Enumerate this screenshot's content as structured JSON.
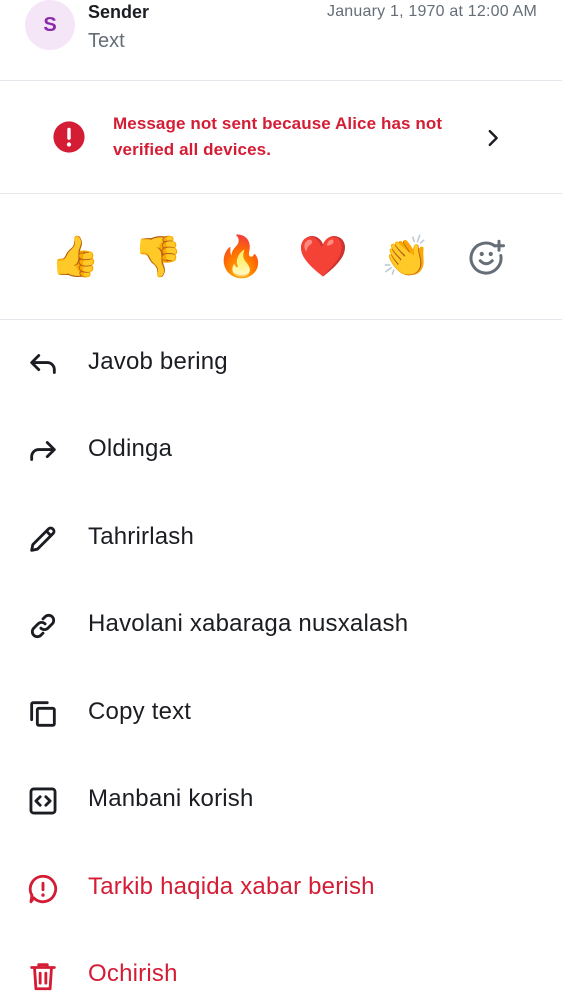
{
  "message": {
    "avatar_initial": "S",
    "sender": "Sender",
    "text": "Text",
    "timestamp": "January 1, 1970 at 12:00 AM"
  },
  "banner": {
    "text": "Message not sent because Alice has not verified all devices.",
    "icon": "error-icon",
    "chevron_icon": "chevron-right-icon"
  },
  "reactions": {
    "items": [
      {
        "name": "thumbs-up",
        "glyph": "👍"
      },
      {
        "name": "thumbs-down",
        "glyph": "👎"
      },
      {
        "name": "fire",
        "glyph": "🔥"
      },
      {
        "name": "heart",
        "glyph": "❤️"
      },
      {
        "name": "clapping-hands",
        "glyph": "👏"
      }
    ],
    "add_icon": "add-reaction-icon"
  },
  "menu": {
    "items": [
      {
        "label": "Javob bering",
        "icon": "reply-icon",
        "danger": false
      },
      {
        "label": "Oldinga",
        "icon": "forward-icon",
        "danger": false
      },
      {
        "label": "Tahrirlash",
        "icon": "edit-icon",
        "danger": false
      },
      {
        "label": "Havolani xabaraga nusxalash",
        "icon": "link-icon",
        "danger": false
      },
      {
        "label": "Copy text",
        "icon": "copy-icon",
        "danger": false
      },
      {
        "label": "Manbani korish",
        "icon": "view-source-icon",
        "danger": false
      },
      {
        "label": "Tarkib haqida xabar berish",
        "icon": "report-icon",
        "danger": true
      },
      {
        "label": "Ochirish",
        "icon": "delete-icon",
        "danger": true
      }
    ]
  },
  "colors": {
    "danger": "#d41d35",
    "secondary_text": "#656d77",
    "avatar_bg": "#f4e6f7",
    "avatar_fg": "#8a2aa8"
  }
}
